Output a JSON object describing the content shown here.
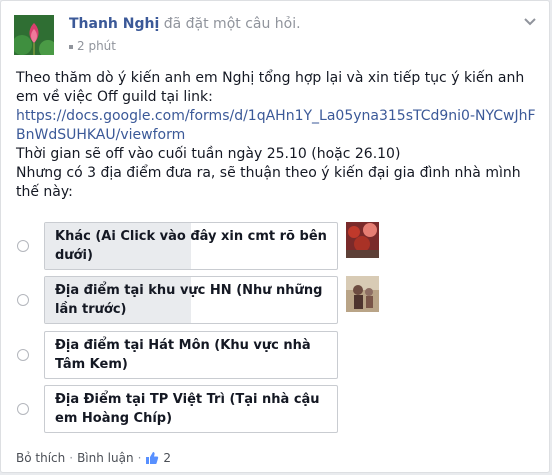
{
  "post": {
    "author": "Thanh Nghị",
    "action_text": "đã đặt một câu hỏi.",
    "time": "2 phút",
    "body_line1": "Theo thăm dò ý kiến anh em Nghị tổng hợp lại và xin tiếp tục ý kiến anh em về việc Off guild tại link:",
    "link": "https://docs.google.com/forms/d/1qAHn1Y_La05yna315sTCd9ni0-NYCwJhFBnWdSUHKAU/viewform",
    "body_line2": "Thời gian sẽ off vào cuối tuần ngày 25.10 (hoặc 26.10)",
    "body_line3": "Nhưng có 3 địa điểm đưa ra, sẽ thuận theo ý kiến đại gia đình nhà mình thế này:"
  },
  "poll": {
    "options": [
      {
        "label": "Khác (Ai Click vào đây xin cmt rõ bên dưới)",
        "fill_fraction": 0.5,
        "has_voter": true
      },
      {
        "label": "Địa điểm tại khu vực HN (Như những lần trước)",
        "fill_fraction": 0.5,
        "has_voter": true
      },
      {
        "label": "Địa điểm tại Hát Môn (Khu vực nhà Tâm Kem)",
        "fill_fraction": 0,
        "has_voter": false
      },
      {
        "label": "Địa Điểm tại TP Việt Trì (Tại nhà cậu em Hoàng Chíp)",
        "fill_fraction": 0,
        "has_voter": false
      }
    ]
  },
  "footer": {
    "like_label": "Bỏ thích",
    "comment_label": "Bình luận",
    "like_count": "2",
    "separator": "·"
  },
  "icons": {
    "menu": "chevron-down-icon",
    "like": "thumbs-up-icon",
    "time": "clock-icon"
  },
  "colors": {
    "link": "#3b5998",
    "meta": "#90949c",
    "vote_bar": "#e9ebee",
    "border": "#c9ccd1"
  }
}
